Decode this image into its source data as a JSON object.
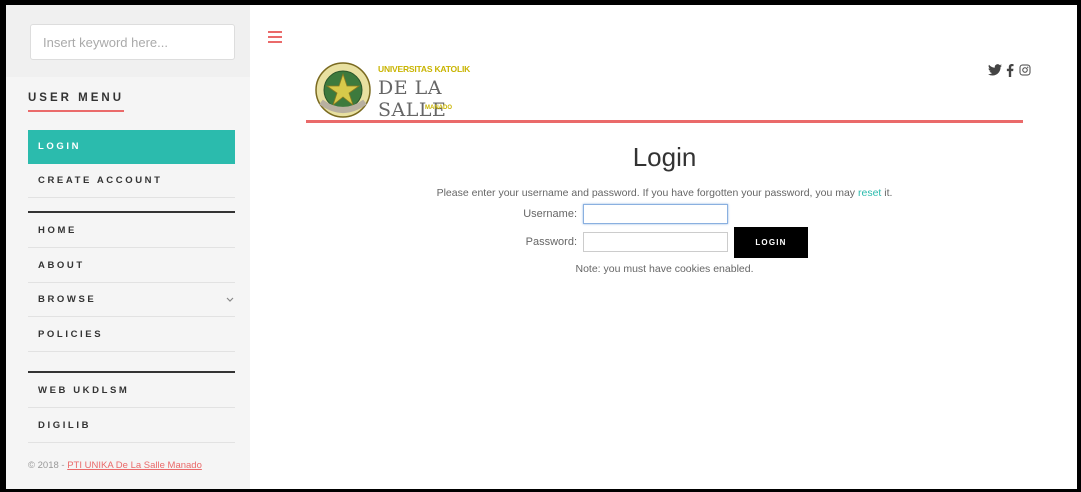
{
  "search": {
    "placeholder": "Insert keyword here..."
  },
  "sidebar": {
    "title": "USER MENU",
    "items": [
      {
        "label": "LOGIN"
      },
      {
        "label": "CREATE ACCOUNT"
      },
      {
        "label": "HOME"
      },
      {
        "label": "ABOUT"
      },
      {
        "label": "BROWSE"
      },
      {
        "label": "POLICIES"
      },
      {
        "label": "WEB UKDLSM"
      },
      {
        "label": "DIGILIB"
      }
    ],
    "footer_prefix": "© 2018 - ",
    "footer_link": "PTI UNIKA De La Salle Manado"
  },
  "logo": {
    "line1": "UNIVERSITAS KATOLIK",
    "line2": "DE LA SALLE",
    "line3": "MANADO"
  },
  "login": {
    "title": "Login",
    "desc_before": "Please enter your username and password. If you have forgotten your password, you may ",
    "desc_link": "reset",
    "desc_after": " it.",
    "username_label": "Username:",
    "password_label": "Password:",
    "username_value": "",
    "password_value": "",
    "button_label": "LOGIN",
    "note": "Note: you must have cookies enabled."
  },
  "colors": {
    "accent": "#ea6a6a",
    "active": "#2bbbad",
    "logo_gold": "#c9b400"
  }
}
